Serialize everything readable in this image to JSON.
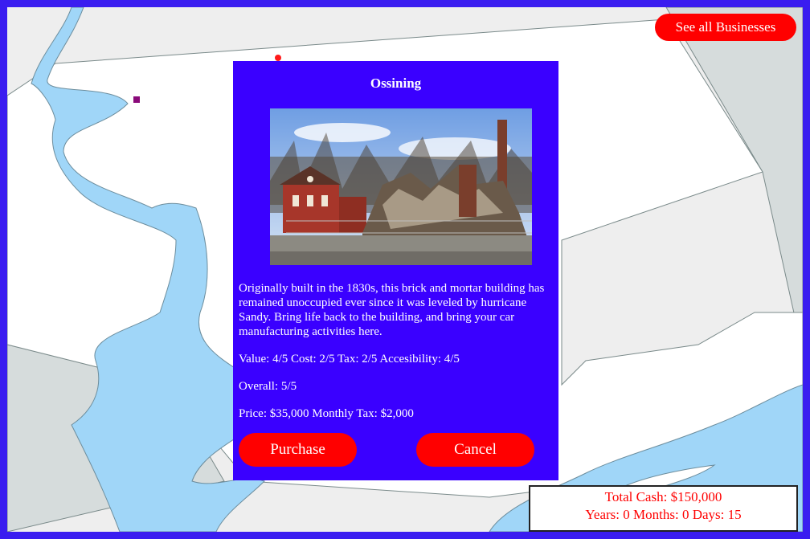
{
  "map": {
    "colors": {
      "water": "#a0d6f8",
      "land_selected": "#ffffff",
      "land_other": "#eeeeee",
      "land_dark": "#d6dcdc",
      "border": "#3a1df0",
      "outline": "#7a8a8a"
    }
  },
  "header": {
    "see_all_label": "See all Businesses"
  },
  "modal": {
    "title": "Ossining",
    "photo_alt": "",
    "description": "Originally built in the 1830s, this brick and mortar building has remained unoccupied ever since it was leveled by hurricane Sandy. Bring life back to the building, and bring your car manufacturing activities here.",
    "stats_line": "Value: 4/5 Cost: 2/5 Tax: 2/5 Accesibility: 4/5",
    "overall_line": "Overall: 5/5",
    "price_line": "Price: $35,000 Monthly Tax: $2,000",
    "purchase_label": "Purchase",
    "cancel_label": "Cancel"
  },
  "status": {
    "total_cash": "Total Cash: $150,000",
    "time": "Years: 0 Months: 0 Days: 15"
  },
  "colors": {
    "accent_red": "#ff0000",
    "modal_bg": "#3a00ff"
  }
}
